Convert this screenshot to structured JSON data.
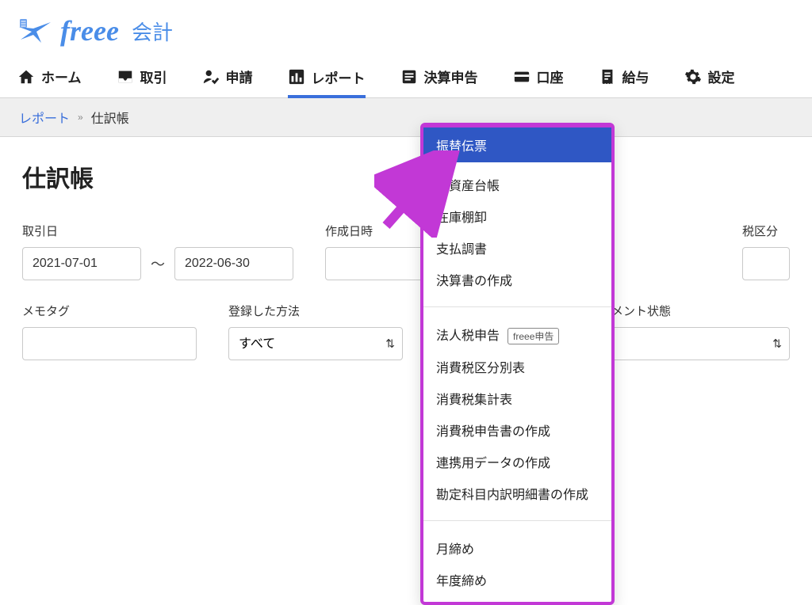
{
  "brand": {
    "name": "freee",
    "product": "会計"
  },
  "nav": {
    "items": [
      {
        "label": "ホーム"
      },
      {
        "label": "取引"
      },
      {
        "label": "申請"
      },
      {
        "label": "レポート"
      },
      {
        "label": "決算申告"
      },
      {
        "label": "口座"
      },
      {
        "label": "給与"
      },
      {
        "label": "設定"
      }
    ]
  },
  "breadcrumb": {
    "root": "レポート",
    "current": "仕訳帳"
  },
  "page": {
    "title": "仕訳帳"
  },
  "filters": {
    "trade_date_label": "取引日",
    "trade_date_from": "2021-07-01",
    "trade_date_to": "2022-06-30",
    "created_at_label": "作成日時",
    "created_at_from": "",
    "created_at_to": "",
    "tax_label": "税区分",
    "memo_label": "メモタグ",
    "memo_value": "",
    "register_label": "登録した方法",
    "register_value": "すべて",
    "comment_label": "コメント状態",
    "comment_value": ""
  },
  "dropdown": {
    "highlight": "振替伝票",
    "groups": [
      [
        "定資産台帳",
        "在庫棚卸",
        "支払調書",
        "決算書の作成"
      ],
      [
        "法人税申告",
        "消費税区分別表",
        "消費税集計表",
        "消費税申告書の作成",
        "連携用データの作成",
        "勘定科目内訳明細書の作成"
      ],
      [
        "月締め",
        "年度締め"
      ]
    ],
    "badge_for": "法人税申告",
    "badge_text": "freee申告"
  },
  "colors": {
    "accent": "#3a6fdb",
    "annotation": "#c238d6",
    "dropdown_highlight_bg": "#2f57c4"
  }
}
